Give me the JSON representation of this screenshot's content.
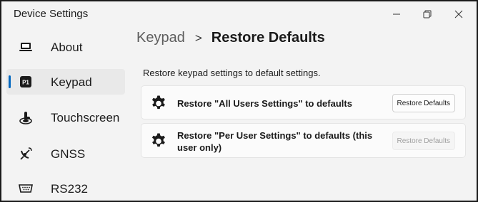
{
  "window": {
    "title": "Device Settings"
  },
  "sidebar": {
    "items": [
      {
        "label": "About",
        "icon": "laptop-icon"
      },
      {
        "label": "Keypad",
        "icon": "keypad-p1-icon",
        "selected": true
      },
      {
        "label": "Touchscreen",
        "icon": "touch-hand-icon"
      },
      {
        "label": "GNSS",
        "icon": "satellite-icon"
      },
      {
        "label": "RS232",
        "icon": "serial-port-icon"
      }
    ]
  },
  "breadcrumb": {
    "parent": "Keypad",
    "separator": ">",
    "current": "Restore Defaults"
  },
  "main": {
    "description": "Restore keypad settings to default settings.",
    "cards": [
      {
        "text": "Restore \"All Users Settings\" to defaults",
        "button": "Restore Defaults",
        "enabled": true,
        "icon": "gear-icon"
      },
      {
        "text": "Restore \"Per User Settings\" to defaults (this user only)",
        "button": "Restore Defaults",
        "enabled": false,
        "icon": "gear-icon"
      }
    ]
  },
  "colors": {
    "accent": "#0067c0",
    "window_bg": "#f3f3f3",
    "card_bg": "#fbfbfb"
  }
}
